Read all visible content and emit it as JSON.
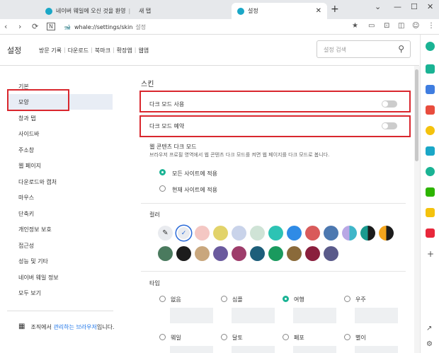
{
  "browser": {
    "tabs": [
      {
        "label": "네이버 웨일에 오신 것을 환영"
      },
      {
        "label": "새 탭"
      },
      {
        "label": "설정"
      }
    ],
    "url": "whale://settings/skin",
    "url_label": "설정"
  },
  "header": {
    "title": "설정",
    "menu": [
      "방문 기록",
      "다운로드",
      "북마크",
      "확장앱",
      "웹앱"
    ],
    "search_placeholder": "설정 검색"
  },
  "sidebar": {
    "items": [
      "기본",
      "모양",
      "창과 탭",
      "사이드바",
      "주소창",
      "웹 페이지",
      "다운로드와 캡처",
      "마우스",
      "단축키",
      "개인정보 보호",
      "접근성",
      "성능 및 기타",
      "네이버 웨일 정보",
      "모두 보기"
    ],
    "active_index": 1,
    "org_text": "조직에서 ",
    "org_link": "관리하는 브라우저",
    "org_suffix": "입니다."
  },
  "main": {
    "section_title": "스킨",
    "dark_mode_label": "다크 모드 사용",
    "dark_mode_on": false,
    "dark_reserve_label": "다크 모드 예약",
    "dark_reserve_on": false,
    "web_dark_title": "웹 콘텐츠 다크 모드",
    "web_dark_desc": "브라우저 프로필 영역에서 웹 콘텐츠 다크 모드를 켜면 웹 페이지를 다크 모드로 봅니다.",
    "web_dark_options": [
      "모든 사이트에 적용",
      "현재 사이트에 적용"
    ],
    "web_dark_selected": 0,
    "color_title": "컬러",
    "colors_row1": [
      "#ffffff",
      "#e9ebef",
      "#f4c7c3",
      "#e2d36a",
      "#c9d3ea",
      "#cfe3d6",
      "#2dc3b4",
      "#2f8be6",
      "#d95b5b",
      "#4c78b0",
      "#b9a7e5",
      "#1a9a8f",
      "#f4a51c"
    ],
    "colors_row2": [
      "#4a7a5e",
      "#1c1c1c",
      "#c9a77d",
      "#6a5a9e",
      "#9e3d6b",
      "#1d5e7a",
      "#1a9a5e",
      "#8a6a3a",
      "#8a1f3d",
      "#5a5a8a"
    ],
    "type_title": "타입",
    "types": [
      "없음",
      "심플",
      "여행",
      "우주",
      "웨일",
      "달토",
      "페포",
      "별이"
    ],
    "type_selected": 2
  }
}
